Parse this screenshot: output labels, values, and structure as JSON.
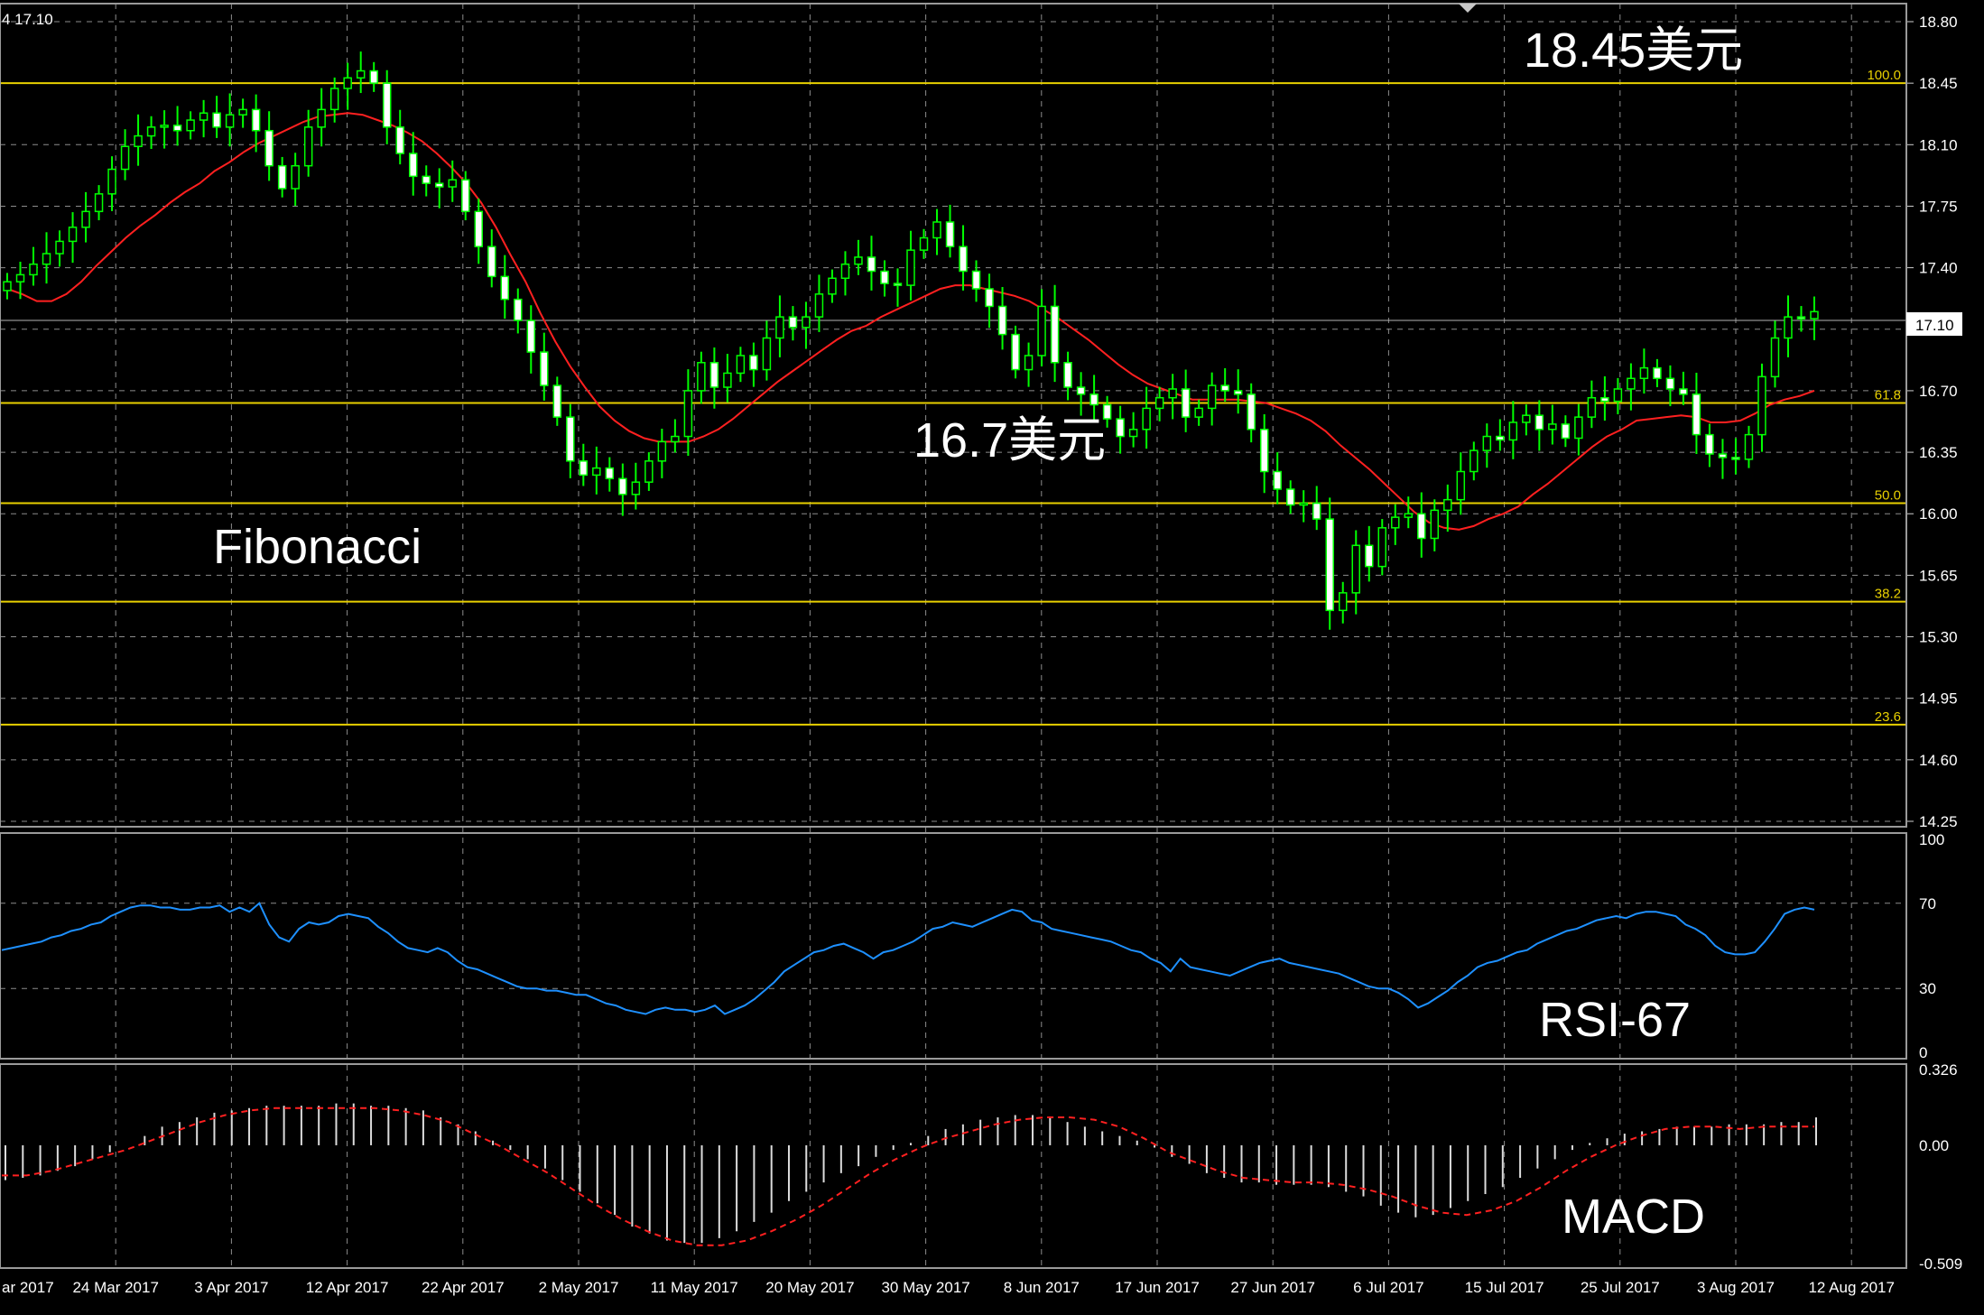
{
  "window": {
    "header_text": "4 17.10",
    "current_price_label": "17.10"
  },
  "annotations": {
    "top_price": "18.45美元",
    "mid_price": "16.7美元",
    "fibonacci": "Fibonacci",
    "rsi": "RSI-67",
    "macd": "MACD"
  },
  "colors": {
    "background": "#000000",
    "grid": "#8c8c8c",
    "bull_candle": "#00ff00",
    "bear_candle": "#ffffff",
    "moving_average": "#ff2020",
    "fib_line": "#e8d000",
    "rsi_line": "#1e90ff",
    "macd_signal": "#ff2020",
    "macd_hist": "#dcdcdc"
  },
  "chart_data": [
    {
      "type": "candlestick",
      "panel": "price",
      "ylim": [
        14.25,
        18.8
      ],
      "y_ticks": [
        "18.80",
        "18.45",
        "18.10",
        "17.75",
        "17.40",
        "17.05",
        "16.70",
        "16.35",
        "16.00",
        "15.65",
        "15.30",
        "14.95",
        "14.60",
        "14.25"
      ],
      "x_tick_labels": [
        "ar 2017",
        "24 Mar 2017",
        "3 Apr 2017",
        "12 Apr 2017",
        "22 Apr 2017",
        "2 May 2017",
        "11 May 2017",
        "20 May 2017",
        "30 May 2017",
        "8 Jun 2017",
        "17 Jun 2017",
        "27 Jun 2017",
        "6 Jul 2017",
        "15 Jul 2017",
        "25 Jul 2017",
        "3 Aug 2017",
        "12 Aug 2017"
      ],
      "fibonacci_levels": [
        {
          "label": "100.0",
          "value": 18.45
        },
        {
          "label": "61.8",
          "value": 16.63
        },
        {
          "label": "50.0",
          "value": 16.06
        },
        {
          "label": "38.2",
          "value": 15.5
        },
        {
          "label": "23.6",
          "value": 14.8
        }
      ],
      "current_price": 17.1,
      "close": [
        17.32,
        17.36,
        17.42,
        17.48,
        17.55,
        17.63,
        17.72,
        17.82,
        17.96,
        18.09,
        18.15,
        18.2,
        18.21,
        18.18,
        18.24,
        18.28,
        18.2,
        18.27,
        18.3,
        18.18,
        17.98,
        17.85,
        17.98,
        18.2,
        18.3,
        18.42,
        18.48,
        18.52,
        18.45,
        18.2,
        18.05,
        17.92,
        17.88,
        17.86,
        17.9,
        17.72,
        17.52,
        17.35,
        17.22,
        17.1,
        16.92,
        16.73,
        16.55,
        16.3,
        16.22,
        16.26,
        16.2,
        16.11,
        16.18,
        16.3,
        16.41,
        16.44,
        16.7,
        16.86,
        16.72,
        16.8,
        16.9,
        16.82,
        17.0,
        17.12,
        17.06,
        17.12,
        17.25,
        17.34,
        17.42,
        17.46,
        17.38,
        17.31,
        17.3,
        17.5,
        17.57,
        17.66,
        17.52,
        17.38,
        17.28,
        17.18,
        17.02,
        16.82,
        16.9,
        17.18,
        16.86,
        16.72,
        16.68,
        16.62,
        16.54,
        16.44,
        16.48,
        16.6,
        16.66,
        16.71,
        16.55,
        16.6,
        16.73,
        16.7,
        16.68,
        16.48,
        16.24,
        16.14,
        16.05,
        16.06,
        15.97,
        15.45,
        15.55,
        15.82,
        15.7,
        15.92,
        15.98,
        16.0,
        15.86,
        16.02,
        16.08,
        16.24,
        16.36,
        16.44,
        16.42,
        16.52,
        16.56,
        16.48,
        16.51,
        16.43,
        16.55,
        16.66,
        16.64,
        16.71,
        16.77,
        16.83,
        16.77,
        16.71,
        16.68,
        16.45,
        16.34,
        16.32,
        16.31,
        16.45,
        16.78,
        17.0,
        17.12,
        17.11,
        17.15
      ],
      "ma_close": [
        17.28,
        17.25,
        17.21,
        17.21,
        17.25,
        17.32,
        17.41,
        17.49,
        17.57,
        17.64,
        17.7,
        17.77,
        17.83,
        17.88,
        17.95,
        18.0,
        18.06,
        18.11,
        18.15,
        18.19,
        18.23,
        18.26,
        18.27,
        18.28,
        18.27,
        18.24,
        18.21,
        18.17,
        18.12,
        18.05,
        17.97,
        17.88,
        17.77,
        17.63,
        17.47,
        17.32,
        17.14,
        16.98,
        16.84,
        16.72,
        16.61,
        16.53,
        16.47,
        16.43,
        16.41,
        16.41,
        16.41,
        16.44,
        16.48,
        16.54,
        16.61,
        16.68,
        16.75,
        16.81,
        16.87,
        16.93,
        16.99,
        17.04,
        17.07,
        17.12,
        17.16,
        17.2,
        17.24,
        17.28,
        17.3,
        17.3,
        17.28,
        17.26,
        17.24,
        17.21,
        17.16,
        17.11,
        17.05,
        16.99,
        16.92,
        16.85,
        16.79,
        16.74,
        16.71,
        16.68,
        16.65,
        16.65,
        16.65,
        16.65,
        16.64,
        16.63,
        16.6,
        16.57,
        16.53,
        16.47,
        16.39,
        16.32,
        16.25,
        16.17,
        16.09,
        16.01,
        15.95,
        15.92,
        15.91,
        15.93,
        15.97,
        16.0,
        16.04,
        16.11,
        16.17,
        16.24,
        16.31,
        16.38,
        16.44,
        16.48,
        16.53,
        16.54,
        16.55,
        16.56,
        16.55,
        16.52,
        16.52,
        16.53,
        16.57,
        16.62,
        16.65,
        16.67,
        16.7
      ],
      "rsi": {
        "ylim": [
          0,
          100
        ],
        "y_ticks": [
          "100",
          "70",
          "30",
          "0"
        ],
        "current_value": 67,
        "values": [
          48,
          49,
          50,
          51,
          52,
          54,
          55,
          57,
          58,
          60,
          61,
          64,
          66,
          68,
          69,
          69,
          68,
          68,
          67,
          67,
          68,
          68,
          69,
          66,
          68,
          66,
          70,
          60,
          54,
          52,
          58,
          61,
          60,
          61,
          64,
          65,
          64,
          63,
          59,
          56,
          52,
          49,
          48,
          47,
          49,
          47,
          43,
          40,
          39,
          37,
          35,
          33,
          31,
          30,
          30,
          29,
          29,
          28,
          27,
          27,
          25,
          23,
          22,
          20,
          19,
          18,
          20,
          21,
          20,
          20,
          19,
          20,
          22,
          18,
          20,
          22,
          25,
          29,
          33,
          38,
          41,
          44,
          47,
          48,
          50,
          51,
          49,
          47,
          44,
          47,
          48,
          50,
          52,
          55,
          58,
          59,
          61,
          60,
          59,
          61,
          63,
          65,
          67,
          66,
          62,
          61,
          58,
          57,
          56,
          55,
          54,
          53,
          52,
          50,
          48,
          47,
          44,
          42,
          38,
          44,
          40,
          39,
          38,
          37,
          36,
          38,
          40,
          42,
          43,
          44,
          42,
          41,
          40,
          39,
          38,
          37,
          35,
          33,
          31,
          30,
          30,
          28,
          25,
          21,
          23,
          26,
          29,
          33,
          36,
          40,
          42,
          43,
          45,
          47,
          48,
          51,
          53,
          55,
          57,
          58,
          60,
          62,
          63,
          64,
          63,
          65,
          66,
          66,
          65,
          64,
          60,
          58,
          55,
          50,
          47,
          46,
          46,
          47,
          52,
          58,
          65,
          67,
          68,
          67
        ]
      },
      "macd": {
        "ylim": [
          -0.509,
          0.326
        ],
        "y_ticks": [
          "0.326",
          "0.00",
          "-0.509"
        ],
        "histogram": [
          -0.15,
          -0.14,
          -0.13,
          -0.11,
          -0.09,
          -0.06,
          -0.03,
          0.0,
          0.04,
          0.08,
          0.1,
          0.12,
          0.14,
          0.15,
          0.16,
          0.17,
          0.17,
          0.17,
          0.17,
          0.18,
          0.18,
          0.17,
          0.17,
          0.16,
          0.15,
          0.12,
          0.09,
          0.06,
          0.02,
          -0.02,
          -0.06,
          -0.1,
          -0.15,
          -0.2,
          -0.25,
          -0.3,
          -0.35,
          -0.38,
          -0.41,
          -0.42,
          -0.42,
          -0.4,
          -0.37,
          -0.33,
          -0.29,
          -0.24,
          -0.2,
          -0.16,
          -0.12,
          -0.09,
          -0.05,
          -0.02,
          0.01,
          0.04,
          0.07,
          0.09,
          0.11,
          0.12,
          0.13,
          0.13,
          0.12,
          0.1,
          0.08,
          0.06,
          0.04,
          0.02,
          -0.01,
          -0.05,
          -0.08,
          -0.12,
          -0.14,
          -0.16,
          -0.16,
          -0.17,
          -0.17,
          -0.17,
          -0.18,
          -0.2,
          -0.22,
          -0.26,
          -0.29,
          -0.31,
          -0.3,
          -0.27,
          -0.24,
          -0.21,
          -0.18,
          -0.14,
          -0.1,
          -0.06,
          -0.02,
          0.01,
          0.03,
          0.05,
          0.06,
          0.07,
          0.08,
          0.08,
          0.08,
          0.09,
          0.09,
          0.09,
          0.1,
          0.1,
          0.12
        ],
        "signal": [
          -0.13,
          -0.13,
          -0.11,
          -0.08,
          -0.05,
          -0.02,
          0.02,
          0.06,
          0.1,
          0.13,
          0.15,
          0.16,
          0.16,
          0.16,
          0.16,
          0.16,
          0.15,
          0.13,
          0.1,
          0.05,
          0.0,
          -0.06,
          -0.12,
          -0.19,
          -0.26,
          -0.32,
          -0.37,
          -0.41,
          -0.43,
          -0.43,
          -0.41,
          -0.37,
          -0.32,
          -0.26,
          -0.19,
          -0.12,
          -0.06,
          -0.01,
          0.03,
          0.06,
          0.09,
          0.11,
          0.12,
          0.12,
          0.11,
          0.08,
          0.03,
          -0.03,
          -0.07,
          -0.11,
          -0.14,
          -0.15,
          -0.16,
          -0.16,
          -0.17,
          -0.19,
          -0.22,
          -0.26,
          -0.29,
          -0.3,
          -0.28,
          -0.24,
          -0.18,
          -0.11,
          -0.05,
          0.0,
          0.04,
          0.07,
          0.08,
          0.08,
          0.07,
          0.08,
          0.08,
          0.08
        ]
      }
    }
  ]
}
